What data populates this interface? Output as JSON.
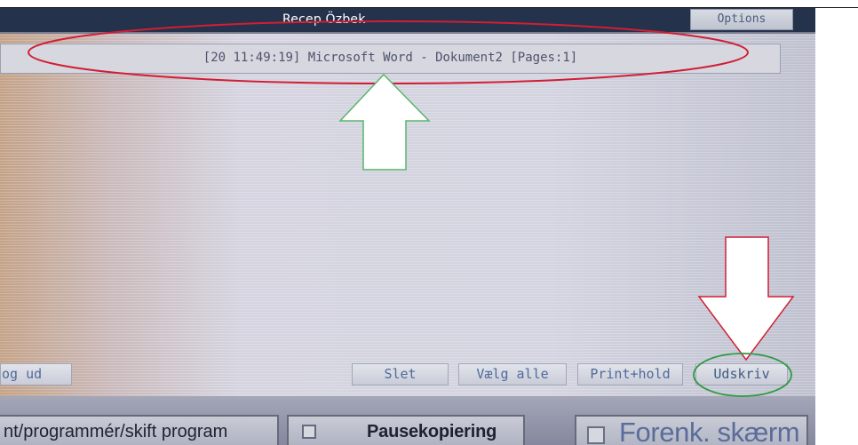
{
  "window": {
    "title": "Recep Özbek",
    "options_label": "Options"
  },
  "job_list": {
    "selected_job": "[20 11:49:19] Microsoft Word - Dokument2 [Pages:1]"
  },
  "actions": {
    "logout_label": "og ud",
    "delete_label": "Slet",
    "select_all_label": "Vælg alle",
    "print_hold_label": "Print+hold",
    "print_label": "Udskriv"
  },
  "hard_keys": {
    "program_label": "nt/programmér/skift program",
    "pause_label": "Pausekopiering",
    "simplified_label": "Forenk. skærm"
  },
  "annotations": {
    "highlight_red": "#d21e35",
    "highlight_green": "#2f9a43",
    "arrow_fill": "#ffffff",
    "arrow_outline": "#59b56c",
    "down_arrow_outline": "#d21e35",
    "icons": [
      "up-arrow-annotation-icon",
      "down-arrow-annotation-icon"
    ]
  }
}
